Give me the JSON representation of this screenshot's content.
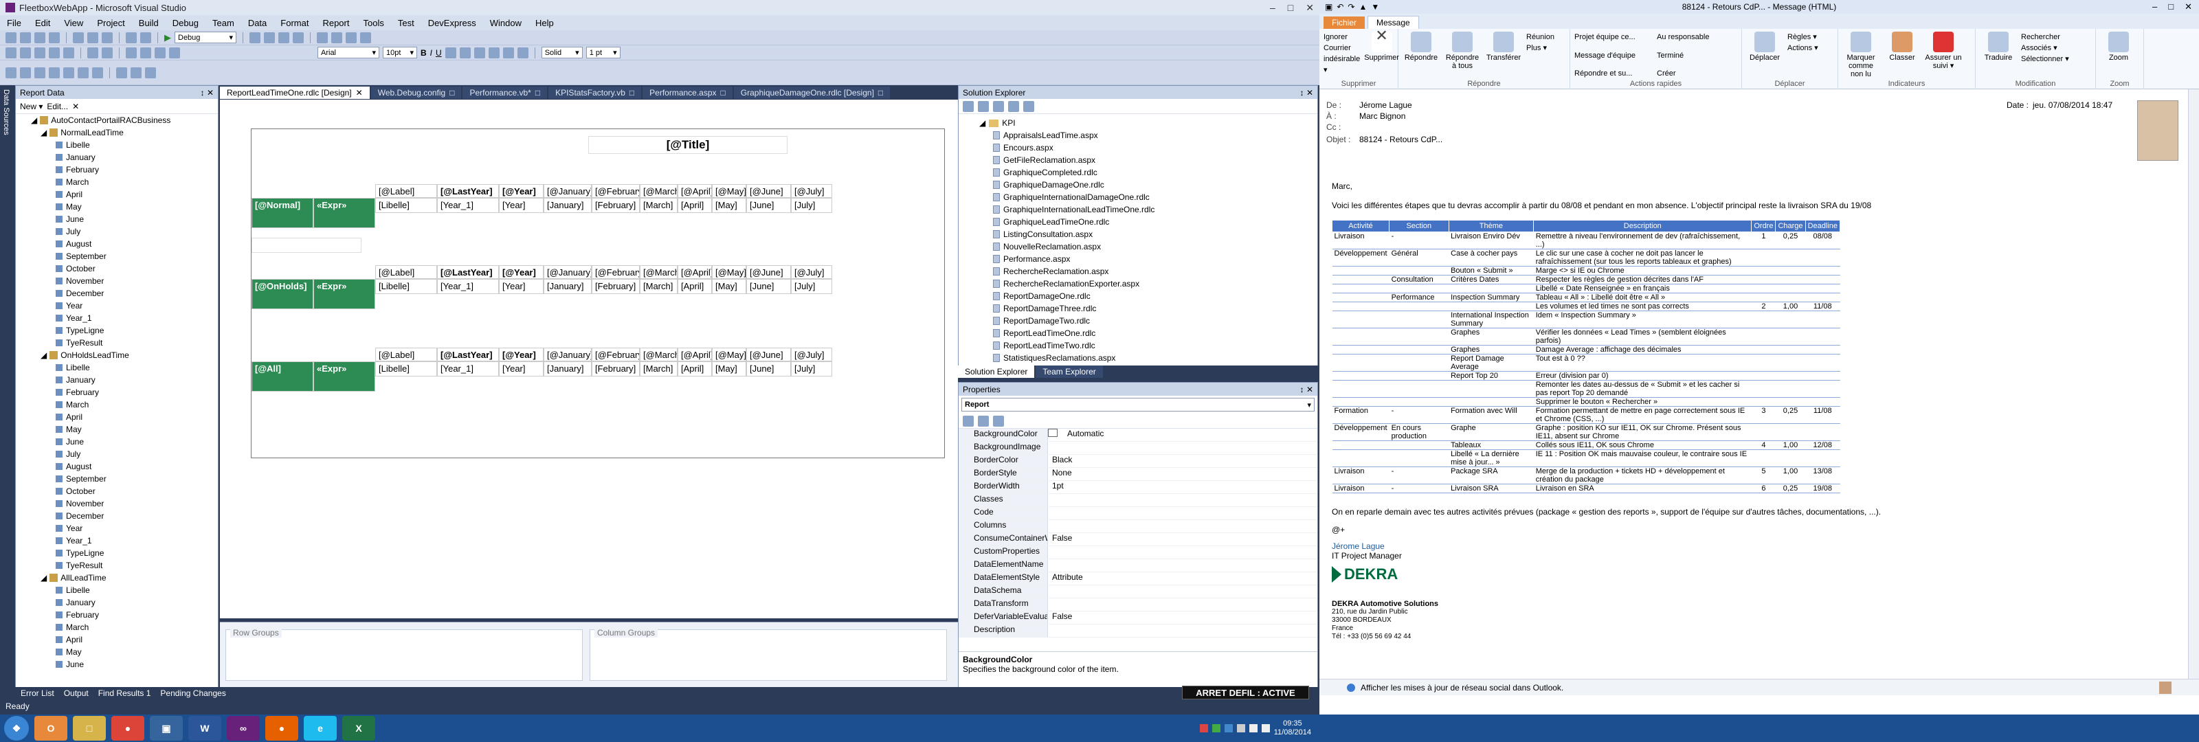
{
  "vs": {
    "title": "FleetboxWebApp - Microsoft Visual Studio",
    "menu": [
      "File",
      "Edit",
      "View",
      "Project",
      "Build",
      "Debug",
      "Team",
      "Data",
      "Format",
      "Report",
      "Tools",
      "Test",
      "DevExpress",
      "Window",
      "Help"
    ],
    "config": "Debug",
    "font_name": "Arial",
    "font_size": "10pt",
    "border_style": "Solid",
    "border_width": "1 pt",
    "side_tools": [
      "Data Sources",
      "Report Data"
    ],
    "report_data": {
      "title": "Report Data",
      "new_label": "New ▾",
      "edit_label": "Edit...",
      "root": "AutoContactPortailRACBusiness",
      "datasets": [
        {
          "name": "NormalLeadTime",
          "fields": [
            "Libelle",
            "January",
            "February",
            "March",
            "April",
            "May",
            "June",
            "July",
            "August",
            "September",
            "October",
            "November",
            "December",
            "Year",
            "Year_1",
            "TypeLigne",
            "TyeResult"
          ]
        },
        {
          "name": "OnHoldsLeadTime",
          "fields": [
            "Libelle",
            "January",
            "February",
            "March",
            "April",
            "May",
            "June",
            "July",
            "August",
            "September",
            "October",
            "November",
            "December",
            "Year",
            "Year_1",
            "TypeLigne",
            "TyeResult"
          ]
        },
        {
          "name": "AllLeadTime",
          "fields": [
            "Libelle",
            "January",
            "February",
            "March",
            "April",
            "May",
            "June"
          ]
        }
      ]
    },
    "doc_tabs": [
      "ReportLeadTimeOne.rdlc [Design]",
      "Web.Debug.config",
      "Performance.vb*",
      "KPIStatsFactory.vb",
      "Performance.aspx",
      "GraphiqueDamageOne.rdlc [Design]"
    ],
    "report": {
      "title_expr": "[@Title]",
      "header_cells": [
        "[@Label]",
        "[@LastYear]",
        "[@Year]",
        "[@January]",
        "[@February]",
        "[@March]",
        "[@April]",
        "[@May]",
        "[@June]",
        "[@July]"
      ],
      "detail_cells": [
        "[Libelle]",
        "[Year_1]",
        "[Year]",
        "[January]",
        "[February]",
        "[March]",
        "[April]",
        "[May]",
        "[June]",
        "[July]"
      ],
      "groups": [
        {
          "label": "[@Normal]",
          "expr": "«Expr»"
        },
        {
          "label": "[@OnHolds]",
          "expr": "«Expr»"
        },
        {
          "label": "[@All]",
          "expr": "«Expr»"
        }
      ]
    },
    "row_groups_label": "Row Groups",
    "column_groups_label": "Column Groups",
    "solution_explorer": {
      "title": "Solution Explorer",
      "folder": "KPI",
      "files": [
        "AppraisalsLeadTime.aspx",
        "Encours.aspx",
        "GetFileReclamation.aspx",
        "GraphiqueCompleted.rdlc",
        "GraphiqueDamageOne.rdlc",
        "GraphiqueInternationalDamageOne.rdlc",
        "GraphiqueInternationalLeadTimeOne.rdlc",
        "GraphiqueLeadTimeOne.rdlc",
        "ListingConsultation.aspx",
        "NouvelleReclamation.aspx",
        "Performance.aspx",
        "RechercheReclamation.aspx",
        "RechercheReclamationExporter.aspx",
        "ReportDamageOne.rdlc",
        "ReportDamageThree.rdlc",
        "ReportDamageTwo.rdlc",
        "ReportLeadTimeOne.rdlc",
        "ReportLeadTimeTwo.rdlc",
        "StatistiquesReclamations.aspx"
      ],
      "tabs": [
        "Solution Explorer",
        "Team Explorer"
      ]
    },
    "properties": {
      "title": "Properties",
      "object": "Report",
      "rows": [
        {
          "name": "BackgroundColor",
          "value": "Automatic"
        },
        {
          "name": "BackgroundImage",
          "value": ""
        },
        {
          "name": "BorderColor",
          "value": "Black"
        },
        {
          "name": "BorderStyle",
          "value": "None"
        },
        {
          "name": "BorderWidth",
          "value": "1pt"
        },
        {
          "name": "Classes",
          "value": ""
        },
        {
          "name": "Code",
          "value": ""
        },
        {
          "name": "Columns",
          "value": ""
        },
        {
          "name": "ConsumeContainerWh",
          "value": "False"
        },
        {
          "name": "CustomProperties",
          "value": ""
        },
        {
          "name": "DataElementName",
          "value": ""
        },
        {
          "name": "DataElementStyle",
          "value": "Attribute"
        },
        {
          "name": "DataSchema",
          "value": ""
        },
        {
          "name": "DataTransform",
          "value": ""
        },
        {
          "name": "DeferVariableEvaluatior",
          "value": "False"
        },
        {
          "name": "Description",
          "value": ""
        }
      ],
      "desc_title": "BackgroundColor",
      "desc_text": "Specifies the background color of the item."
    },
    "bottom_tabs": [
      "Error List",
      "Output",
      "Find Results 1",
      "Pending Changes"
    ],
    "status": "Ready",
    "arret": "ARRET DEFIL : ACTIVE"
  },
  "taskbar": {
    "clock_time": "09:35",
    "clock_date": "11/08/2014"
  },
  "outlook": {
    "title": "88124 - Retours CdP... - Message (HTML)",
    "tabs": [
      "Fichier",
      "Message"
    ],
    "ribbon": {
      "supprimer_group": "Supprimer",
      "ignorer": "Ignorer",
      "courrier": "Courrier indésirable ▾",
      "supprimer": "Supprimer",
      "repondre_group": "Répondre",
      "repondre": "Répondre",
      "repondre_tous": "Répondre à tous",
      "transferer": "Transférer",
      "reunion": "Réunion",
      "plus": "Plus ▾",
      "actions_group": "Actions rapides",
      "actions": [
        "Projet équipe ce...",
        "Au responsable",
        "Message d'équipe",
        "Terminé",
        "Répondre et su...",
        "Créer"
      ],
      "deplacer_group": "Déplacer",
      "deplacer": "Déplacer",
      "regles": "Règles ▾",
      "actions_menu": "Actions ▾",
      "indicateurs_group": "Indicateurs",
      "marquer": "Marquer comme non lu",
      "classer": "Classer",
      "assurer": "Assurer un suivi ▾",
      "modification_group": "Modification",
      "traduire": "Traduire",
      "rechercher": "Rechercher",
      "associes": "Associés ▾",
      "selectionner": "Sélectionner ▾",
      "zoom_group": "Zoom",
      "zoom": "Zoom"
    },
    "header": {
      "de_label": "De :",
      "de": "Jérome Lague",
      "a_label": "À :",
      "a": "Marc Bignon",
      "cc_label": "Cc :",
      "objet_label": "Objet :",
      "objet": "88124 - Retours CdP...",
      "date_label": "Date :",
      "date": "jeu. 07/08/2014 18:47"
    },
    "body": {
      "greeting": "Marc,",
      "intro": "Voici les différentes étapes que tu devras accomplir à partir du 08/08 et pendant en mon absence. L'objectif principal reste la livraison SRA du 19/08",
      "columns": [
        "Activité",
        "Section",
        "Thème",
        "Description",
        "Ordre",
        "Charge",
        "Deadline"
      ],
      "rows": [
        [
          "Livraison",
          "-",
          "Livraison Enviro Dév",
          "Remettre à niveau l'environnement de dev (rafraîchissement, ...)",
          "1",
          "0,25",
          "08/08"
        ],
        [
          "Développement",
          "Général",
          "Case à cocher pays",
          "Le clic sur une case à cocher ne doit pas lancer le rafraîchissement (sur tous les reports tableaux et graphes)",
          "",
          "",
          ""
        ],
        [
          "",
          "",
          "Bouton « Submit »",
          "Marge <> si IE ou Chrome",
          "",
          "",
          ""
        ],
        [
          "",
          "Consultation",
          "Critères Dates",
          "Respecter les règles de gestion décrites dans l'AF",
          "",
          "",
          ""
        ],
        [
          "",
          "",
          "",
          "Libellé « Date Renseignée » en français",
          "",
          "",
          ""
        ],
        [
          "",
          "Performance",
          "Inspection Summary",
          "Tableau « All » : Libellé doit être « All »",
          "",
          "",
          ""
        ],
        [
          "",
          "",
          "",
          "Les volumes et led times ne sont pas corrects",
          "2",
          "1,00",
          "11/08"
        ],
        [
          "",
          "",
          "International Inspection Summary",
          "Idem « Inspection Summary »",
          "",
          "",
          ""
        ],
        [
          "",
          "",
          "Graphes",
          "Vérifier les données « Lead Times » (semblent éloignées parfois)",
          "",
          "",
          ""
        ],
        [
          "",
          "",
          "Graphes",
          "Damage Average : affichage des décimales",
          "",
          "",
          ""
        ],
        [
          "",
          "",
          "Report Damage Average",
          "Tout est à 0 ??",
          "",
          "",
          ""
        ],
        [
          "",
          "",
          "Report Top 20",
          "Erreur (division par 0)",
          "",
          "",
          ""
        ],
        [
          "",
          "",
          "",
          "Remonter les dates au-dessus de « Submit » et les cacher si pas report Top 20 demandé",
          "",
          "",
          ""
        ],
        [
          "",
          "",
          "",
          "Supprimer le bouton « Rechercher »",
          "",
          "",
          ""
        ],
        [
          "Formation",
          "-",
          "Formation avec Will",
          "Formation permettant de mettre en page correctement sous IE et Chrome (CSS, ...)",
          "3",
          "0,25",
          "11/08"
        ],
        [
          "Développement",
          "En cours production",
          "Graphe",
          "Graphe : position KO sur IE11, OK sur Chrome. Présent sous IE11, absent sur Chrome",
          "",
          "",
          ""
        ],
        [
          "",
          "",
          "Tableaux",
          "Collés sous IE11, OK sous Chrome",
          "4",
          "1,00",
          "12/08"
        ],
        [
          "",
          "",
          "Libellé « La dernière mise à jour... »",
          "IE 11 : Position OK mais mauvaise couleur, le contraire sous IE",
          "",
          "",
          ""
        ],
        [
          "Livraison",
          "-",
          "Package SRA",
          "Merge de la production + tickets HD + développement et création du package",
          "5",
          "1,00",
          "13/08"
        ],
        [
          "Livraison",
          "-",
          "Livraison SRA",
          "Livraison en SRA",
          "6",
          "0,25",
          "19/08"
        ]
      ],
      "outro": "On en reparle demain avec tes autres activités prévues (package « gestion des reports », support de l'équipe sur d'autres tâches, documentations, ...).",
      "closing": "@+",
      "sig_name": "Jérome Lague",
      "sig_role": "IT Project Manager",
      "logo": "DEKRA",
      "company": "DEKRA Automotive Solutions",
      "addr1": "210, rue du Jardin Public",
      "addr2": "33000 BORDEAUX",
      "country": "France",
      "tel": "Tél : +33 (0)5 56 69 42 44"
    },
    "social": "Afficher les mises à jour de réseau social dans Outlook."
  },
  "colors": {
    "accent_green": "#2d8b54",
    "vs_frame": "#2b3b58",
    "outlook_table_header": "#4472c4",
    "file_tab": "#e8883a"
  }
}
